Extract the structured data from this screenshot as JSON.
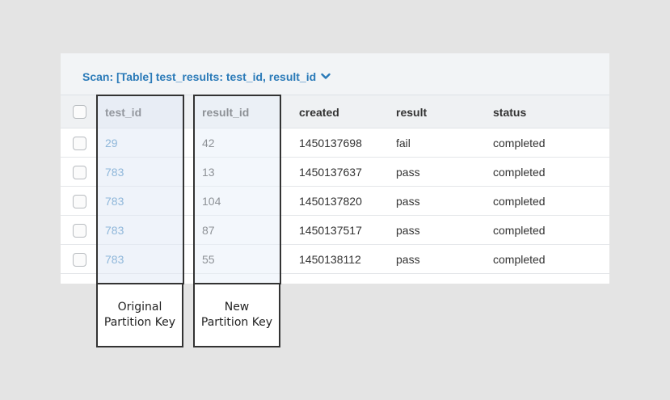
{
  "scan_header": {
    "label": "Scan: [Table] test_results: test_id, result_id"
  },
  "table": {
    "columns": [
      "test_id",
      "result_id",
      "created",
      "result",
      "status"
    ],
    "rows": [
      {
        "test_id": "29",
        "result_id": "42",
        "created": "1450137698",
        "result": "fail",
        "status": "completed"
      },
      {
        "test_id": "783",
        "result_id": "13",
        "created": "1450137637",
        "result": "pass",
        "status": "completed"
      },
      {
        "test_id": "783",
        "result_id": "104",
        "created": "1450137820",
        "result": "pass",
        "status": "completed"
      },
      {
        "test_id": "783",
        "result_id": "87",
        "created": "1450137517",
        "result": "pass",
        "status": "completed"
      },
      {
        "test_id": "783",
        "result_id": "55",
        "created": "1450138112",
        "result": "pass",
        "status": "completed"
      }
    ]
  },
  "annotations": {
    "original": {
      "line1": "Original",
      "line2": "Partition Key"
    },
    "new": {
      "line1": "New",
      "line2": "Partition Key"
    }
  },
  "colors": {
    "link": "#2a7ab8",
    "outline": "#333333",
    "background": "#e4e4e4"
  }
}
